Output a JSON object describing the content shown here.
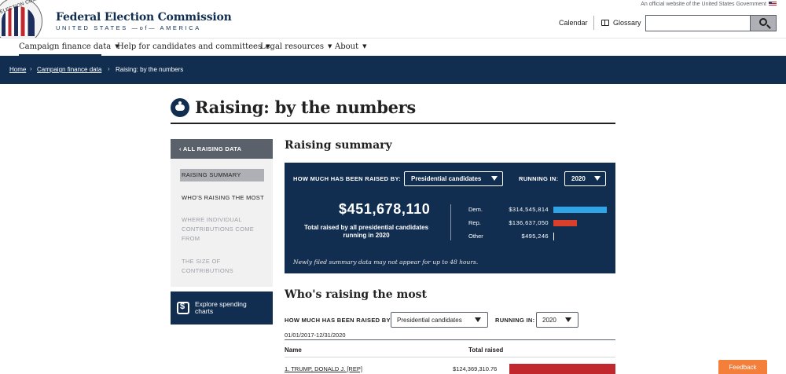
{
  "gov_banner": "An official website of the United States Government",
  "header": {
    "seal_text": "ELECTION COMMISSION",
    "title": "Federal Election Commission",
    "subtitle": "UNITED STATES —of— AMERICA",
    "calendar": "Calendar",
    "glossary": "Glossary",
    "search_placeholder": ""
  },
  "nav": {
    "items": [
      {
        "label": "Campaign finance data"
      },
      {
        "label": "Help for candidates and committees"
      },
      {
        "label": "Legal resources"
      },
      {
        "label": "About"
      }
    ],
    "caret": "▼"
  },
  "breadcrumb": {
    "items": [
      "Home",
      "Campaign finance data",
      "Raising: by the numbers"
    ],
    "sep": "›"
  },
  "page": {
    "title": "Raising: by the numbers"
  },
  "sidebar": {
    "all_link": "‹ ALL RAISING DATA",
    "items": [
      {
        "label": "RAISING SUMMARY"
      },
      {
        "label": "WHO'S RAISING THE MOST"
      },
      {
        "label": "WHERE INDIVIDUAL CONTRIBUTIONS COME FROM"
      },
      {
        "label": "THE SIZE OF CONTRIBUTIONS"
      }
    ],
    "cta": "Explore spending charts"
  },
  "summary": {
    "heading": "Raising summary",
    "how_label": "HOW MUCH HAS BEEN RAISED BY:",
    "candidates_select": "Presidential candidates",
    "running_label": "RUNNING IN:",
    "year_select": "2020",
    "total": "$451,678,110",
    "caption": "Total raised by all presidential candidates running in 2020",
    "parties": [
      {
        "name": "Dem.",
        "amount": "$314,545,814",
        "value": 314545814,
        "color": "#2fa4e7"
      },
      {
        "name": "Rep.",
        "amount": "$136,637,050",
        "value": 136637050,
        "color": "#d9402b"
      },
      {
        "name": "Other",
        "amount": "$495,246",
        "value": 495246,
        "color": "#ffffff"
      }
    ],
    "note": "Newly filed summary data may not appear for up to 48 hours."
  },
  "who": {
    "heading": "Who's raising the most",
    "how_label": "HOW MUCH HAS BEEN RAISED BY:",
    "candidates_select": "Presidential candidates",
    "running_label": "RUNNING IN:",
    "year_select": "2020",
    "dates": "01/01/2017-12/31/2020",
    "col_name": "Name",
    "col_total": "Total raised",
    "rows": [
      {
        "name": "1. TRUMP, DONALD J. [REP]",
        "total": "$124,369,310.76"
      }
    ]
  },
  "feedback": "Feedback"
}
